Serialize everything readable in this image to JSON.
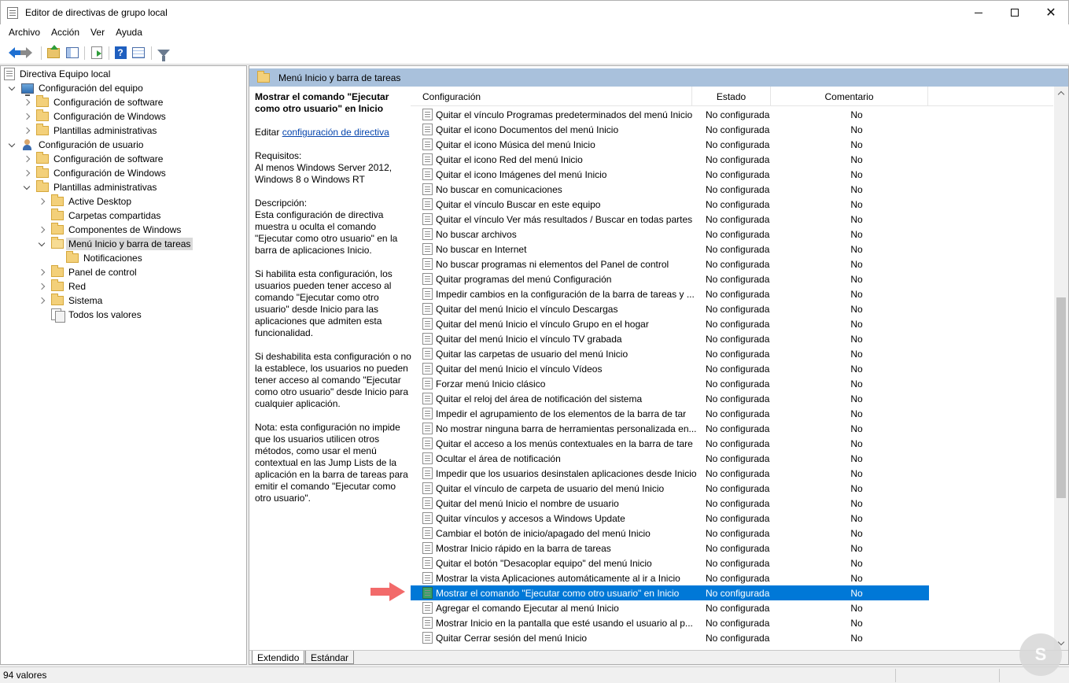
{
  "window": {
    "title": "Editor de directivas de grupo local"
  },
  "menu": [
    "Archivo",
    "Acción",
    "Ver",
    "Ayuda"
  ],
  "toolbar": {
    "icons": [
      "back-arrow-icon",
      "forward-arrow-icon",
      "folder-up-icon",
      "show-hide-tree-icon",
      "export-list-icon",
      "help-icon",
      "properties-icon",
      "filter-icon"
    ]
  },
  "tree": [
    {
      "label": "Directiva Equipo local",
      "level": 0,
      "icon": "document-icon",
      "chevron": "none"
    },
    {
      "label": "Configuración del equipo",
      "level": 1,
      "icon": "computer-icon",
      "chevron": "down"
    },
    {
      "label": "Configuración de software",
      "level": 2,
      "icon": "folder-icon",
      "chevron": "right"
    },
    {
      "label": "Configuración de Windows",
      "level": 2,
      "icon": "folder-icon",
      "chevron": "right"
    },
    {
      "label": "Plantillas administrativas",
      "level": 2,
      "icon": "folder-icon",
      "chevron": "right"
    },
    {
      "label": "Configuración de usuario",
      "level": 1,
      "icon": "user-icon",
      "chevron": "down"
    },
    {
      "label": "Configuración de software",
      "level": 2,
      "icon": "folder-icon",
      "chevron": "right"
    },
    {
      "label": "Configuración de Windows",
      "level": 2,
      "icon": "folder-icon",
      "chevron": "right"
    },
    {
      "label": "Plantillas administrativas",
      "level": 2,
      "icon": "folder-icon",
      "chevron": "down"
    },
    {
      "label": "Active Desktop",
      "level": 3,
      "icon": "folder-icon",
      "chevron": "right"
    },
    {
      "label": "Carpetas compartidas",
      "level": 3,
      "icon": "folder-icon",
      "chevron": "none"
    },
    {
      "label": "Componentes de Windows",
      "level": 3,
      "icon": "folder-icon",
      "chevron": "right"
    },
    {
      "label": "Menú Inicio y barra de tareas",
      "level": 3,
      "icon": "folder-open-icon",
      "chevron": "down",
      "selected": true
    },
    {
      "label": "Notificaciones",
      "level": 4,
      "icon": "folder-icon",
      "chevron": "none"
    },
    {
      "label": "Panel de control",
      "level": 3,
      "icon": "folder-icon",
      "chevron": "right"
    },
    {
      "label": "Red",
      "level": 3,
      "icon": "folder-icon",
      "chevron": "right"
    },
    {
      "label": "Sistema",
      "level": 3,
      "icon": "folder-icon",
      "chevron": "right"
    },
    {
      "label": "Todos los valores",
      "level": 3,
      "icon": "all-settings-icon",
      "chevron": "none"
    }
  ],
  "path_header": "Menú Inicio y barra de tareas",
  "description": {
    "title": "Mostrar el comando \"Ejecutar como otro usuario\" en Inicio",
    "edit_prefix": "Editar ",
    "edit_link": "configuración de directiva",
    "requirements": "Requisitos:\nAl menos Windows Server 2012, Windows 8 o Windows RT",
    "description": "Descripción:\nEsta configuración de directiva muestra u oculta el comando \"Ejecutar como otro usuario\" en la barra de aplicaciones Inicio.",
    "enabled": "Si habilita esta configuración, los usuarios pueden tener acceso al comando \"Ejecutar como otro usuario\" desde Inicio para las aplicaciones que admiten esta funcionalidad.",
    "disabled": "Si deshabilita esta configuración o no la establece, los usuarios no pueden tener acceso al comando \"Ejecutar como otro usuario\" desde Inicio para cualquier aplicación.",
    "note": "Nota: esta configuración no impide que los usuarios utilicen otros métodos, como usar el menú contextual en las Jump Lists de la aplicación en la barra de tareas para emitir el comando \"Ejecutar como otro usuario\"."
  },
  "columns": [
    "Configuración",
    "Estado",
    "Comentario"
  ],
  "rows": [
    {
      "name": "Quitar el vínculo Programas predeterminados del menú Inicio",
      "state": "No configurada",
      "comment": "No"
    },
    {
      "name": "Quitar el icono Documentos del menú Inicio",
      "state": "No configurada",
      "comment": "No"
    },
    {
      "name": "Quitar el icono Música del menú Inicio",
      "state": "No configurada",
      "comment": "No"
    },
    {
      "name": "Quitar el icono Red del menú Inicio",
      "state": "No configurada",
      "comment": "No"
    },
    {
      "name": "Quitar el icono Imágenes del menú Inicio",
      "state": "No configurada",
      "comment": "No"
    },
    {
      "name": "No buscar en comunicaciones",
      "state": "No configurada",
      "comment": "No"
    },
    {
      "name": "Quitar el vínculo Buscar en este equipo",
      "state": "No configurada",
      "comment": "No"
    },
    {
      "name": "Quitar el vínculo Ver más resultados / Buscar en todas partes",
      "state": "No configurada",
      "comment": "No"
    },
    {
      "name": "No buscar archivos",
      "state": "No configurada",
      "comment": "No"
    },
    {
      "name": "No buscar en Internet",
      "state": "No configurada",
      "comment": "No"
    },
    {
      "name": "No buscar programas ni elementos del Panel de control",
      "state": "No configurada",
      "comment": "No"
    },
    {
      "name": "Quitar programas del menú Configuración",
      "state": "No configurada",
      "comment": "No"
    },
    {
      "name": "Impedir cambios en la configuración de la barra de tareas y ...",
      "state": "No configurada",
      "comment": "No"
    },
    {
      "name": "Quitar del menú Inicio el vínculo Descargas",
      "state": "No configurada",
      "comment": "No"
    },
    {
      "name": "Quitar del menú Inicio el vínculo Grupo en el hogar",
      "state": "No configurada",
      "comment": "No"
    },
    {
      "name": "Quitar del menú Inicio el vínculo TV grabada",
      "state": "No configurada",
      "comment": "No"
    },
    {
      "name": "Quitar las carpetas de usuario del menú Inicio",
      "state": "No configurada",
      "comment": "No"
    },
    {
      "name": "Quitar del menú Inicio el vínculo Vídeos",
      "state": "No configurada",
      "comment": "No"
    },
    {
      "name": "Forzar menú Inicio clásico",
      "state": "No configurada",
      "comment": "No"
    },
    {
      "name": "Quitar el reloj del área de notificación del sistema",
      "state": "No configurada",
      "comment": "No"
    },
    {
      "name": "Impedir el agrupamiento de los elementos de la barra de tar",
      "state": "No configurada",
      "comment": "No"
    },
    {
      "name": "No mostrar ninguna barra de herramientas personalizada en...",
      "state": "No configurada",
      "comment": "No"
    },
    {
      "name": "Quitar el acceso a los menús contextuales en la barra de tare",
      "state": "No configurada",
      "comment": "No"
    },
    {
      "name": "Ocultar el área de notificación",
      "state": "No configurada",
      "comment": "No"
    },
    {
      "name": "Impedir que los usuarios desinstalen aplicaciones desde Inicio",
      "state": "No configurada",
      "comment": "No"
    },
    {
      "name": "Quitar el vínculo de carpeta de usuario del menú Inicio",
      "state": "No configurada",
      "comment": "No"
    },
    {
      "name": "Quitar del menú Inicio el nombre de usuario",
      "state": "No configurada",
      "comment": "No"
    },
    {
      "name": "Quitar vínculos y accesos a Windows Update",
      "state": "No configurada",
      "comment": "No"
    },
    {
      "name": "Cambiar el botón de inicio/apagado del menú Inicio",
      "state": "No configurada",
      "comment": "No"
    },
    {
      "name": "Mostrar Inicio rápido en la barra de tareas",
      "state": "No configurada",
      "comment": "No"
    },
    {
      "name": "Quitar el botón \"Desacoplar equipo\" del menú Inicio",
      "state": "No configurada",
      "comment": "No"
    },
    {
      "name": "Mostrar la vista Aplicaciones automáticamente al ir a Inicio",
      "state": "No configurada",
      "comment": "No"
    },
    {
      "name": "Mostrar el comando \"Ejecutar como otro usuario\" en Inicio",
      "state": "No configurada",
      "comment": "No",
      "selected": true
    },
    {
      "name": "Agregar el comando Ejecutar al menú Inicio",
      "state": "No configurada",
      "comment": "No"
    },
    {
      "name": "Mostrar Inicio en la pantalla que esté usando el usuario al p...",
      "state": "No configurada",
      "comment": "No"
    },
    {
      "name": "Quitar Cerrar sesión del menú Inicio",
      "state": "No configurada",
      "comment": "No"
    }
  ],
  "tabs": [
    "Extendido",
    "Estándar"
  ],
  "status": {
    "text": "94 valores"
  },
  "colors": {
    "selection": "#0078d7",
    "path_bar": "#a9c1dc",
    "annotation_arrow": "#f26a6a"
  }
}
